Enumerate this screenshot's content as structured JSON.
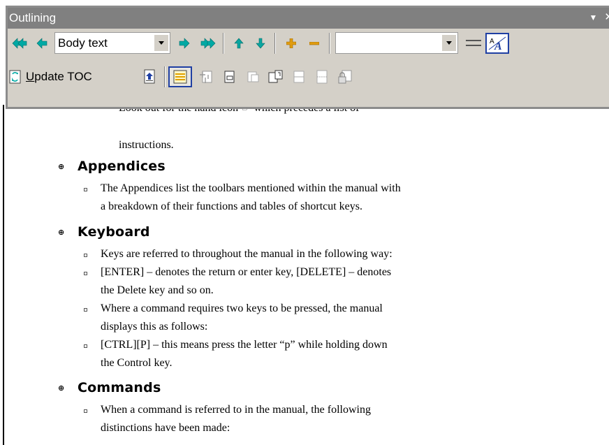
{
  "toolbar": {
    "title": "Outlining",
    "title_buttons": [
      "▼",
      "✕"
    ],
    "outline_level": {
      "value": "Body text"
    },
    "show_level": {
      "value": ""
    },
    "update_toc_label": "Update TOC",
    "update_toc_mnemonic": "U",
    "update_toc_rest": "pdate TOC",
    "icons_row1": [
      "promote-to-heading1-icon",
      "promote-icon",
      "demote-icon",
      "demote-to-body-text-icon",
      "move-up-icon",
      "move-down-icon",
      "expand-icon",
      "collapse-icon",
      "show-first-line-icon",
      "show-formatting-icon"
    ],
    "icons_row2": [
      "update-toc-icon",
      "go-to-toc-icon",
      "master-document-view-icon",
      "collapse-subdocuments-icon",
      "create-subdocument-icon",
      "remove-subdocument-icon",
      "insert-subdocument-icon",
      "merge-subdocument-icon",
      "split-subdocument-icon",
      "lock-document-icon"
    ],
    "accent_color": "#1f3fa3",
    "arrow_color": "#00a9a4",
    "updown_color": "#0aa5a0",
    "plusminus_color": "#e09c10"
  },
  "document": {
    "cut_line": "Look out for the hand icon ☞ which precedes a list of",
    "intro_continuation": "instructions.",
    "sections": [
      {
        "heading": "Appendices",
        "items": [
          "The Appendices list the toolbars mentioned within the manual with",
          "a breakdown of their functions and tables of shortcut keys."
        ]
      },
      {
        "heading": "Keyboard",
        "items": [
          "Keys are referred to throughout the manual in the following way:",
          "[ENTER] – denotes the return or enter key, [DELETE] – denotes",
          "the Delete key and so on.",
          "Where a command requires two keys to be pressed, the manual",
          "displays this as follows:",
          "[CTRL][P] – this means press the letter “p” while holding down",
          "the Control key."
        ]
      },
      {
        "heading": "Commands",
        "items": [
          "When a command is referred to in the manual, the following",
          "distinctions have been made:"
        ]
      }
    ]
  }
}
